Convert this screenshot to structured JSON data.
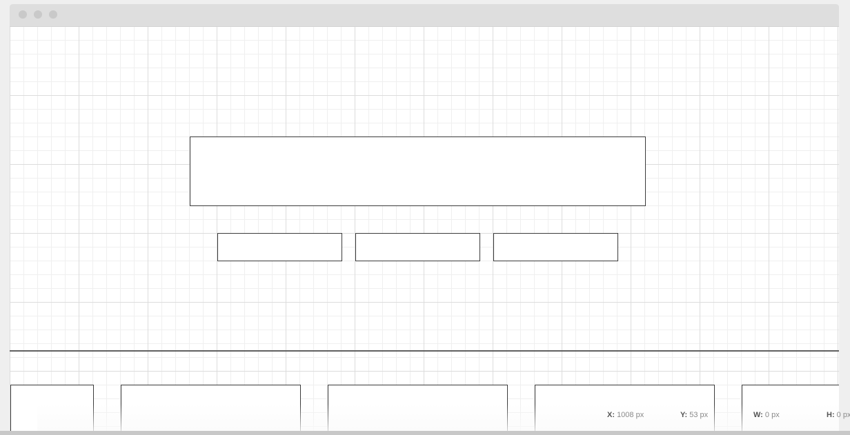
{
  "window": {
    "controls": [
      "close-button",
      "minimize-button",
      "maximize-button"
    ]
  },
  "readout": {
    "x_label": "X:",
    "x_value": "1008 px",
    "y_label": "Y:",
    "y_value": "53 px",
    "w_label": "W:",
    "w_value": "0 px",
    "h_label": "H:",
    "h_value": "0 px"
  },
  "colors": {
    "titlebar": "#dedede",
    "grid_major": "#dcdcdc",
    "grid_minor": "#efefef",
    "box_border": "#3a3a3a",
    "divider": "#5f5f5f"
  }
}
